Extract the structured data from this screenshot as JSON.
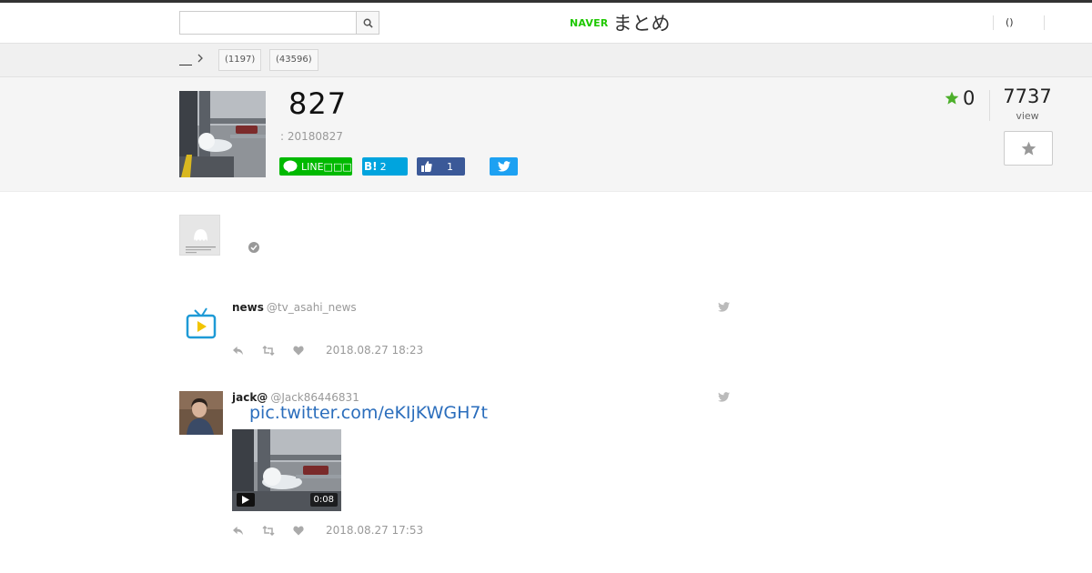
{
  "header": {
    "search_placeholder": "",
    "logo_naver": "NAVER",
    "logo_matome": "まとめ",
    "user_link": "()"
  },
  "breadcrumb": {
    "tags": [
      "(1197)",
      "(43596)"
    ]
  },
  "article": {
    "title": "827",
    "updated": ": 20180827",
    "share": {
      "line_label": "LINE□□□",
      "hatena_label": "B!",
      "hatena_count": "2",
      "facebook_count": "1"
    },
    "fav_count": "0",
    "view_count": "7737",
    "view_label": "view"
  },
  "tweets": [
    {
      "name": "news",
      "handle": "@tv_asahi_news",
      "time": "2018.08.27 18:23"
    },
    {
      "name": "jack@",
      "handle": "@Jack86446831",
      "link": "pic.twitter.com/eKIjKWGH7t",
      "duration": "0:08",
      "time": "2018.08.27 17:53"
    }
  ],
  "colors": {
    "brand_green": "#1ec800",
    "line_green": "#00b900",
    "hatena_blue": "#00a4de",
    "facebook_blue": "#3b5998",
    "twitter_blue": "#1da1f2",
    "link_blue": "#2a6dbc"
  },
  "icons": [
    "search-icon",
    "chevron-right-icon",
    "star-icon",
    "line-icon",
    "thumbs-up-icon",
    "twitter-bird-icon",
    "verified-icon",
    "reply-icon",
    "retweet-icon",
    "heart-icon",
    "play-icon",
    "tv-icon"
  ]
}
